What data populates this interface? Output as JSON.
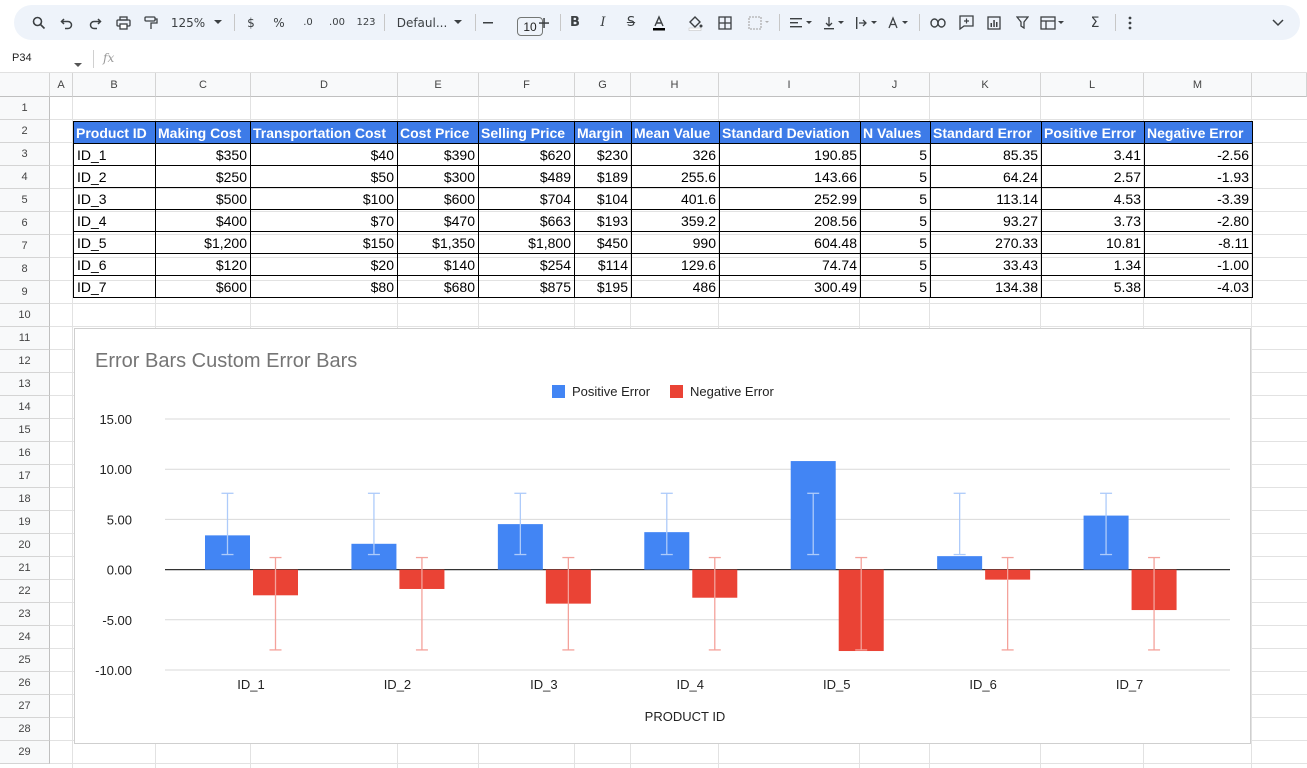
{
  "toolbar": {
    "zoom": "125%",
    "currency": "$",
    "percent": "%",
    "dec_decrease": ".0",
    "dec_increase": ".00",
    "more_formats": "123",
    "font": "Defaul...",
    "font_size": "10",
    "icons": [
      "search-icon",
      "undo-icon",
      "redo-icon",
      "print-icon",
      "paint-format-icon",
      "currency-icon",
      "percent-icon",
      "bold-icon",
      "italic-icon",
      "strikethrough-icon",
      "text-color-icon",
      "fill-color-icon",
      "borders-icon",
      "merge-icon",
      "align-icon",
      "valign-icon",
      "wrap-icon",
      "rotate-icon",
      "link-icon",
      "comment-icon",
      "chart-icon",
      "filter-icon",
      "table-icon",
      "sum-icon",
      "more-icon",
      "collapse-icon"
    ]
  },
  "formula_bar": {
    "cell_ref": "P34",
    "fx": "fx"
  },
  "columns": [
    "A",
    "B",
    "C",
    "D",
    "E",
    "F",
    "G",
    "H",
    "I",
    "J",
    "K",
    "L",
    "M"
  ],
  "rows": [
    "1",
    "2",
    "3",
    "4",
    "5",
    "6",
    "7",
    "8",
    "9",
    "10",
    "11",
    "12",
    "13",
    "14",
    "15",
    "16",
    "17",
    "18",
    "19",
    "20",
    "21",
    "22",
    "23",
    "24",
    "25",
    "26",
    "27",
    "28",
    "29"
  ],
  "table": {
    "headers": [
      "Product ID",
      "Making Cost",
      "Transportation Cost",
      "Cost Price",
      "Selling Price",
      "Margin",
      "Mean Value",
      "Standard Deviation",
      "N Values",
      "Standard Error",
      "Positive Error",
      "Negative Error"
    ],
    "rows": [
      [
        "ID_1",
        "$350",
        "$40",
        "$390",
        "$620",
        "$230",
        "326",
        "190.85",
        "5",
        "85.35",
        "3.41",
        "-2.56"
      ],
      [
        "ID_2",
        "$250",
        "$50",
        "$300",
        "$489",
        "$189",
        "255.6",
        "143.66",
        "5",
        "64.24",
        "2.57",
        "-1.93"
      ],
      [
        "ID_3",
        "$500",
        "$100",
        "$600",
        "$704",
        "$104",
        "401.6",
        "252.99",
        "5",
        "113.14",
        "4.53",
        "-3.39"
      ],
      [
        "ID_4",
        "$400",
        "$70",
        "$470",
        "$663",
        "$193",
        "359.2",
        "208.56",
        "5",
        "93.27",
        "3.73",
        "-2.80"
      ],
      [
        "ID_5",
        "$1,200",
        "$150",
        "$1,350",
        "$1,800",
        "$450",
        "990",
        "604.48",
        "5",
        "270.33",
        "10.81",
        "-8.11"
      ],
      [
        "ID_6",
        "$120",
        "$20",
        "$140",
        "$254",
        "$114",
        "129.6",
        "74.74",
        "5",
        "33.43",
        "1.34",
        "-1.00"
      ],
      [
        "ID_7",
        "$600",
        "$80",
        "$680",
        "$875",
        "$195",
        "486",
        "300.49",
        "5",
        "134.38",
        "5.38",
        "-4.03"
      ]
    ]
  },
  "chart_data": {
    "type": "bar",
    "title": "Error Bars Custom Error Bars",
    "xlabel": "PRODUCT ID",
    "ylabel": "",
    "categories": [
      "ID_1",
      "ID_2",
      "ID_3",
      "ID_4",
      "ID_5",
      "ID_6",
      "ID_7"
    ],
    "series": [
      {
        "name": "Positive Error",
        "color": "#4285f4",
        "error_bar_color": "#aecbfa",
        "values": [
          3.41,
          2.57,
          4.53,
          3.73,
          10.81,
          1.34,
          5.38
        ],
        "error_low": 1.5,
        "error_high": 7.6
      },
      {
        "name": "Negative Error",
        "color": "#ea4335",
        "error_bar_color": "#f4a29b",
        "values": [
          -2.56,
          -1.93,
          -3.39,
          -2.8,
          -8.11,
          -1.0,
          -4.03
        ],
        "error_low": -8.0,
        "error_high": 1.2
      }
    ],
    "ylim": [
      -10,
      15
    ],
    "yticks": [
      "15.00",
      "10.00",
      "5.00",
      "0.00",
      "-5.00",
      "-10.00"
    ],
    "ytick_values": [
      15,
      10,
      5,
      0,
      -5,
      -10
    ],
    "legend": "top",
    "grid": true
  }
}
